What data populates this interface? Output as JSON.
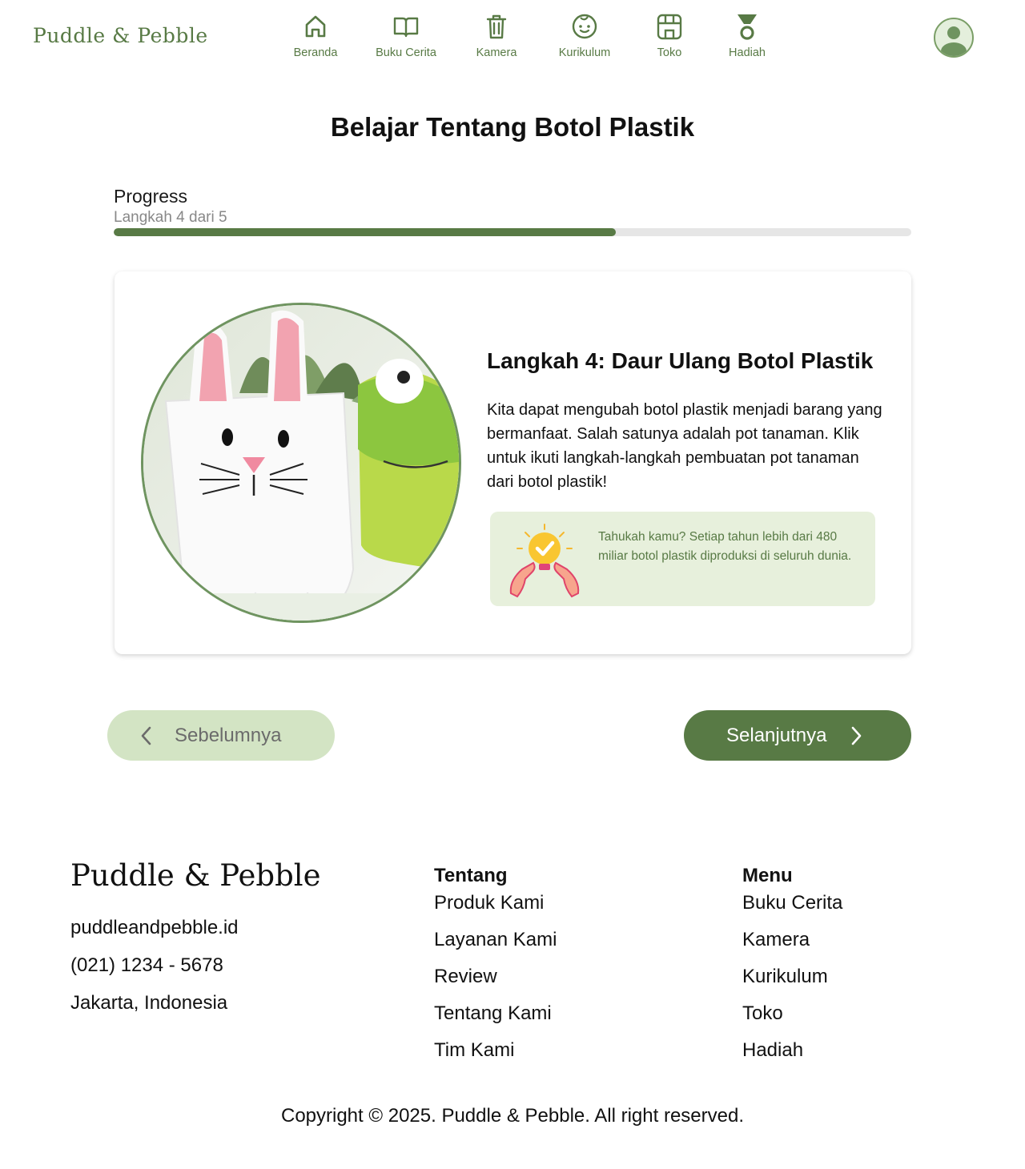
{
  "brand": {
    "name": "Puddle & Pebble"
  },
  "nav": {
    "items": [
      {
        "label": "Beranda",
        "icon": "home-icon"
      },
      {
        "label": "Buku Cerita",
        "icon": "book-icon"
      },
      {
        "label": "Kamera",
        "icon": "trash-icon"
      },
      {
        "label": "Kurikulum",
        "icon": "child-face-icon"
      },
      {
        "label": "Toko",
        "icon": "store-icon"
      },
      {
        "label": "Hadiah",
        "icon": "medal-icon"
      }
    ],
    "profile_icon": "user-avatar-icon"
  },
  "page": {
    "title": "Belajar Tentang Botol Plastik"
  },
  "progress": {
    "title": "Progress",
    "subtitle": "Langkah 4 dari 5",
    "fraction": 0.63
  },
  "step": {
    "title": "Langkah 4: Daur Ulang Botol Plastik",
    "description": "Kita dapat mengubah botol plastik menjadi barang yang bermanfaat. Salah satunya adalah pot tanaman. Klik untuk ikuti langkah-langkah pembuatan pot tanaman dari botol plastik!",
    "image": "bottle-planter-photo",
    "fact": "Tahukah kamu? Setiap tahun lebih dari 480 miliar botol plastik diproduksi di seluruh dunia.",
    "fact_icon": "lightbulb-hands-icon"
  },
  "buttons": {
    "prev": "Sebelumnya",
    "next": "Selanjutnya"
  },
  "footer": {
    "brand": "Puddle & Pebble",
    "contact": [
      "puddleandpebble.id",
      "(021) 1234 - 5678",
      "Jakarta, Indonesia"
    ],
    "about": {
      "title": "Tentang",
      "links": [
        "Produk Kami",
        "Layanan Kami",
        "Review",
        "Tentang Kami",
        "Tim Kami"
      ]
    },
    "menu": {
      "title": "Menu",
      "links": [
        "Buku Cerita",
        "Kamera",
        "Kurikulum",
        "Toko",
        "Hadiah"
      ]
    },
    "copyright": "Copyright © 2025. Puddle & Pebble. All right reserved."
  },
  "colors": {
    "primary": "#587a45",
    "light": "#d3e4c4",
    "fact_bg": "#e7f0dc",
    "track": "#e6e6e6"
  }
}
